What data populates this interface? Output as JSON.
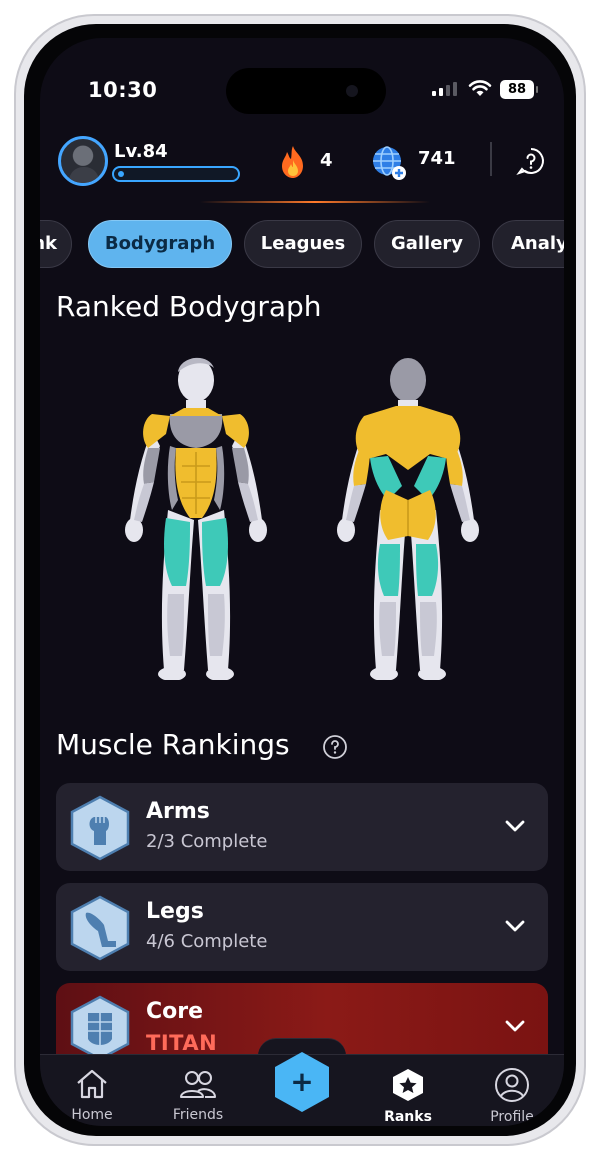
{
  "status_bar": {
    "time": "10:30",
    "battery": "88"
  },
  "header": {
    "level": "Lv.84",
    "xp_progress": 0.05,
    "streak": "4",
    "gems": "741",
    "icons": {
      "streak": "fire-icon",
      "gems": "globe-icon",
      "help": "help-icon"
    }
  },
  "tabs": [
    {
      "label": "Rank",
      "active": false
    },
    {
      "label": "Bodygraph",
      "active": true
    },
    {
      "label": "Leagues",
      "active": false
    },
    {
      "label": "Gallery",
      "active": false
    },
    {
      "label": "Analytics",
      "active": false
    }
  ],
  "bodygraph": {
    "title": "Ranked Bodygraph",
    "colors": {
      "gold": "#f0bd2e",
      "teal": "#3ec9b8",
      "unranked": "#9a9aa6",
      "base": "#e6e6ee"
    }
  },
  "rankings": {
    "title": "Muscle Rankings",
    "items": [
      {
        "name": "Arms",
        "status": "2/3 Complete",
        "icon": "arm-icon"
      },
      {
        "name": "Legs",
        "status": "4/6 Complete",
        "icon": "leg-icon"
      },
      {
        "name": "Core",
        "status": "TITAN",
        "icon": "abs-icon",
        "highlight": "#8b1a17"
      }
    ]
  },
  "nav": {
    "items": [
      {
        "label": "Home",
        "icon": "home-icon"
      },
      {
        "label": "Friends",
        "icon": "friends-icon"
      },
      {
        "label": "Ranks",
        "icon": "ranks-icon",
        "active": true
      },
      {
        "label": "Profile",
        "icon": "profile-icon"
      }
    ],
    "add_label": "+"
  }
}
